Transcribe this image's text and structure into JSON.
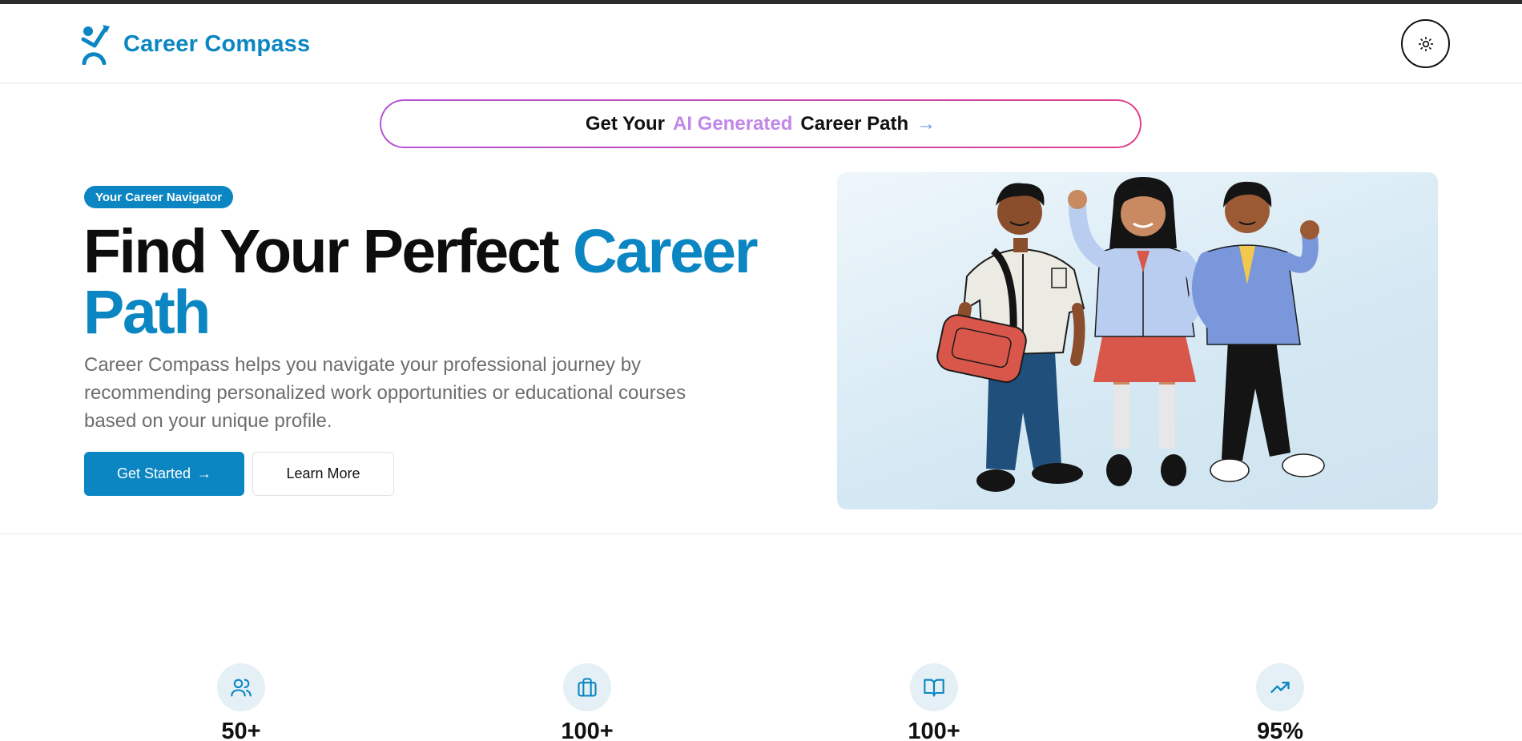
{
  "header": {
    "brand_name": "Career Compass",
    "logo_icon": "compass-person-icon",
    "theme_toggle_icon": "sun-icon"
  },
  "ai_banner": {
    "prefix": "Get Your",
    "highlight": "AI Generated",
    "suffix": "Career Path",
    "arrow": "→"
  },
  "hero": {
    "badge": "Your Career Navigator",
    "title_dark": "Find Your Perfect ",
    "title_accent": "Career Path",
    "description": "Career Compass helps you navigate your professional journey by recommending personalized work opportunities or educational courses based on your unique profile.",
    "primary_button": "Get Started",
    "primary_button_arrow": "→",
    "secondary_button": "Learn More",
    "image_description_icon": "students-illustration"
  },
  "stats": [
    {
      "icon": "users-icon",
      "value": "50+"
    },
    {
      "icon": "briefcase-icon",
      "value": "100+"
    },
    {
      "icon": "book-open-icon",
      "value": "100+"
    },
    {
      "icon": "trending-up-icon",
      "value": "95%"
    }
  ],
  "colors": {
    "brand": "#0b86c2",
    "ai_accent": "#c087e8",
    "pill_gradient_start": "#b654d6",
    "pill_gradient_end": "#e0408f"
  }
}
